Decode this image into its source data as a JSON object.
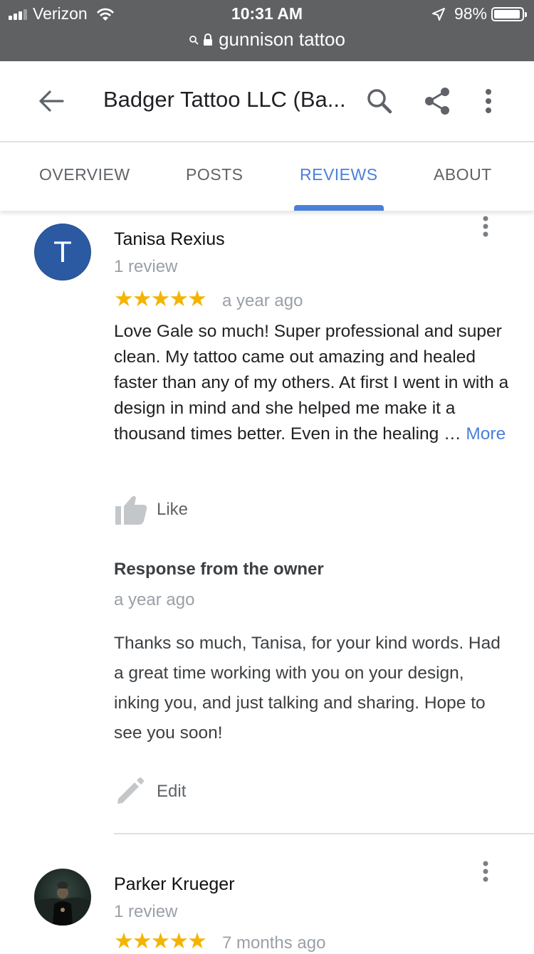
{
  "status_bar": {
    "carrier": "Verizon",
    "time": "10:31 AM",
    "battery": "98%",
    "url": "gunnison tattoo"
  },
  "header": {
    "title": "Badger Tattoo LLC (Ba...",
    "icons": [
      "arrow-back-icon",
      "search-icon",
      "share-icon",
      "more-vert-icon"
    ]
  },
  "tabs": [
    {
      "label": "OVERVIEW"
    },
    {
      "label": "POSTS"
    },
    {
      "label": "REVIEWS",
      "active": true
    },
    {
      "label": "ABOUT"
    }
  ],
  "reviews": [
    {
      "avatar_letter": "T",
      "name": "Tanisa Rexius",
      "count": "1 review",
      "rating": 5,
      "stars": "★★★★★",
      "date": "a year ago",
      "text": "Love Gale so much!  Super professional and super clean. My tattoo came out amazing and healed faster than any of my others. At first I went in with a design in mind and she helped me make it a thousand times better. Even in the healing … ",
      "more_label": "More",
      "like_label": "Like",
      "owner_response": {
        "title": "Response from the owner",
        "date": "a year ago",
        "text": "Thanks so much, Tanisa, for your kind words. Had a great time working with you on your design, inking you, and just talking and sharing. Hope to see you soon!"
      },
      "edit_label": "Edit"
    },
    {
      "name": "Parker Krueger",
      "count": "1 review",
      "rating": 5,
      "stars": "★★★★★",
      "date": "7 months ago"
    }
  ],
  "colors": {
    "status_bar": "#5f6163",
    "accent": "#4a80d9",
    "star": "#f4b400",
    "avatar_bg": "#2b5aa3"
  }
}
